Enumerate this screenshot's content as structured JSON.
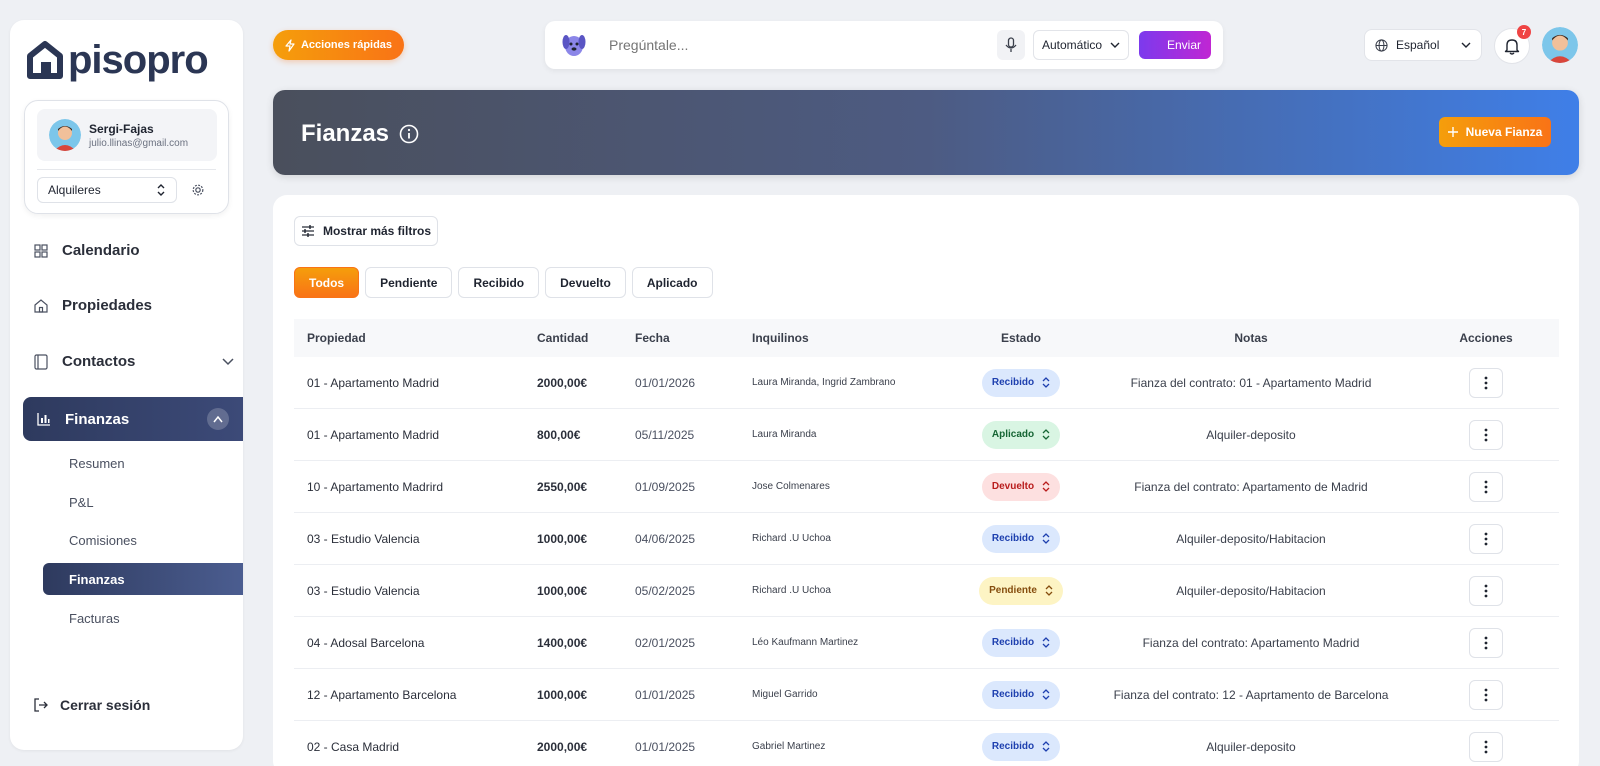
{
  "brand": {
    "name": "pisopro"
  },
  "user": {
    "name": "Sergi-Fajas",
    "email": "julio.llinas@gmail.com",
    "mode": "Alquileres"
  },
  "sidebar": {
    "calendario": "Calendario",
    "propiedades": "Propiedades",
    "contactos": "Contactos",
    "finanzas": "Finanzas",
    "sub": [
      "Resumen",
      "P&L",
      "Comisiones",
      "Finanzas",
      "Facturas"
    ],
    "logout": "Cerrar sesión"
  },
  "topbar": {
    "quick_actions": "Acciones rápidas",
    "ask_placeholder": "Pregúntale...",
    "mode": "Automático",
    "send": "Enviar",
    "language": "Español",
    "notifications_count": "7"
  },
  "page": {
    "title": "Fianzas",
    "new_button": "Nueva Fianza"
  },
  "filters": {
    "more_filters": "Mostrar más filtros"
  },
  "tabs": [
    "Todos",
    "Pendiente",
    "Recibido",
    "Devuelto",
    "Aplicado"
  ],
  "table": {
    "headers": [
      "Propiedad",
      "Cantidad",
      "Fecha",
      "Inquilinos",
      "Estado",
      "Notas",
      "Acciones"
    ],
    "rows": [
      {
        "propiedad": "01 - Apartamento Madrid",
        "cantidad": "2000,00€",
        "fecha": "01/01/2026",
        "inquilinos": "Laura Miranda, Ingrid Zambrano",
        "estado": "Recibido",
        "notas": "Fianza del contrato: 01 - Apartamento Madrid"
      },
      {
        "propiedad": "01 - Apartamento Madrid",
        "cantidad": "800,00€",
        "fecha": "05/11/2025",
        "inquilinos": "Laura Miranda",
        "estado": "Aplicado",
        "notas": "Alquiler-deposito"
      },
      {
        "propiedad": "10 - Apartamento Madrird",
        "cantidad": "2550,00€",
        "fecha": "01/09/2025",
        "inquilinos": "Jose Colmenares",
        "estado": "Devuelto",
        "notas": "Fianza del contrato: Apartamento de Madrid"
      },
      {
        "propiedad": "03 - Estudio Valencia",
        "cantidad": "1000,00€",
        "fecha": "04/06/2025",
        "inquilinos": "Richard .U Uchoa",
        "estado": "Recibido",
        "notas": "Alquiler-deposito/Habitacion"
      },
      {
        "propiedad": "03 - Estudio Valencia",
        "cantidad": "1000,00€",
        "fecha": "05/02/2025",
        "inquilinos": "Richard .U Uchoa",
        "estado": "Pendiente",
        "notas": "Alquiler-deposito/Habitacion"
      },
      {
        "propiedad": "04 - Adosal Barcelona",
        "cantidad": "1400,00€",
        "fecha": "02/01/2025",
        "inquilinos": "Léo Kaufmann Martinez",
        "estado": "Recibido",
        "notas": "Fianza del contrato: Apartamento Madrid"
      },
      {
        "propiedad": "12 - Apartamento Barcelona",
        "cantidad": "1000,00€",
        "fecha": "01/01/2025",
        "inquilinos": "Miguel Garrido",
        "estado": "Recibido",
        "notas": "Fianza del contrato: 12 - Aaprtamento de Barcelona"
      },
      {
        "propiedad": "02 - Casa Madrid",
        "cantidad": "2000,00€",
        "fecha": "01/01/2025",
        "inquilinos": "Gabriel Martinez",
        "estado": "Recibido",
        "notas": "Alquiler-deposito"
      }
    ]
  },
  "colors": {
    "accent": "#f97316",
    "nav_active": "#2e3a5e",
    "banner_end": "#3f7fe8"
  }
}
